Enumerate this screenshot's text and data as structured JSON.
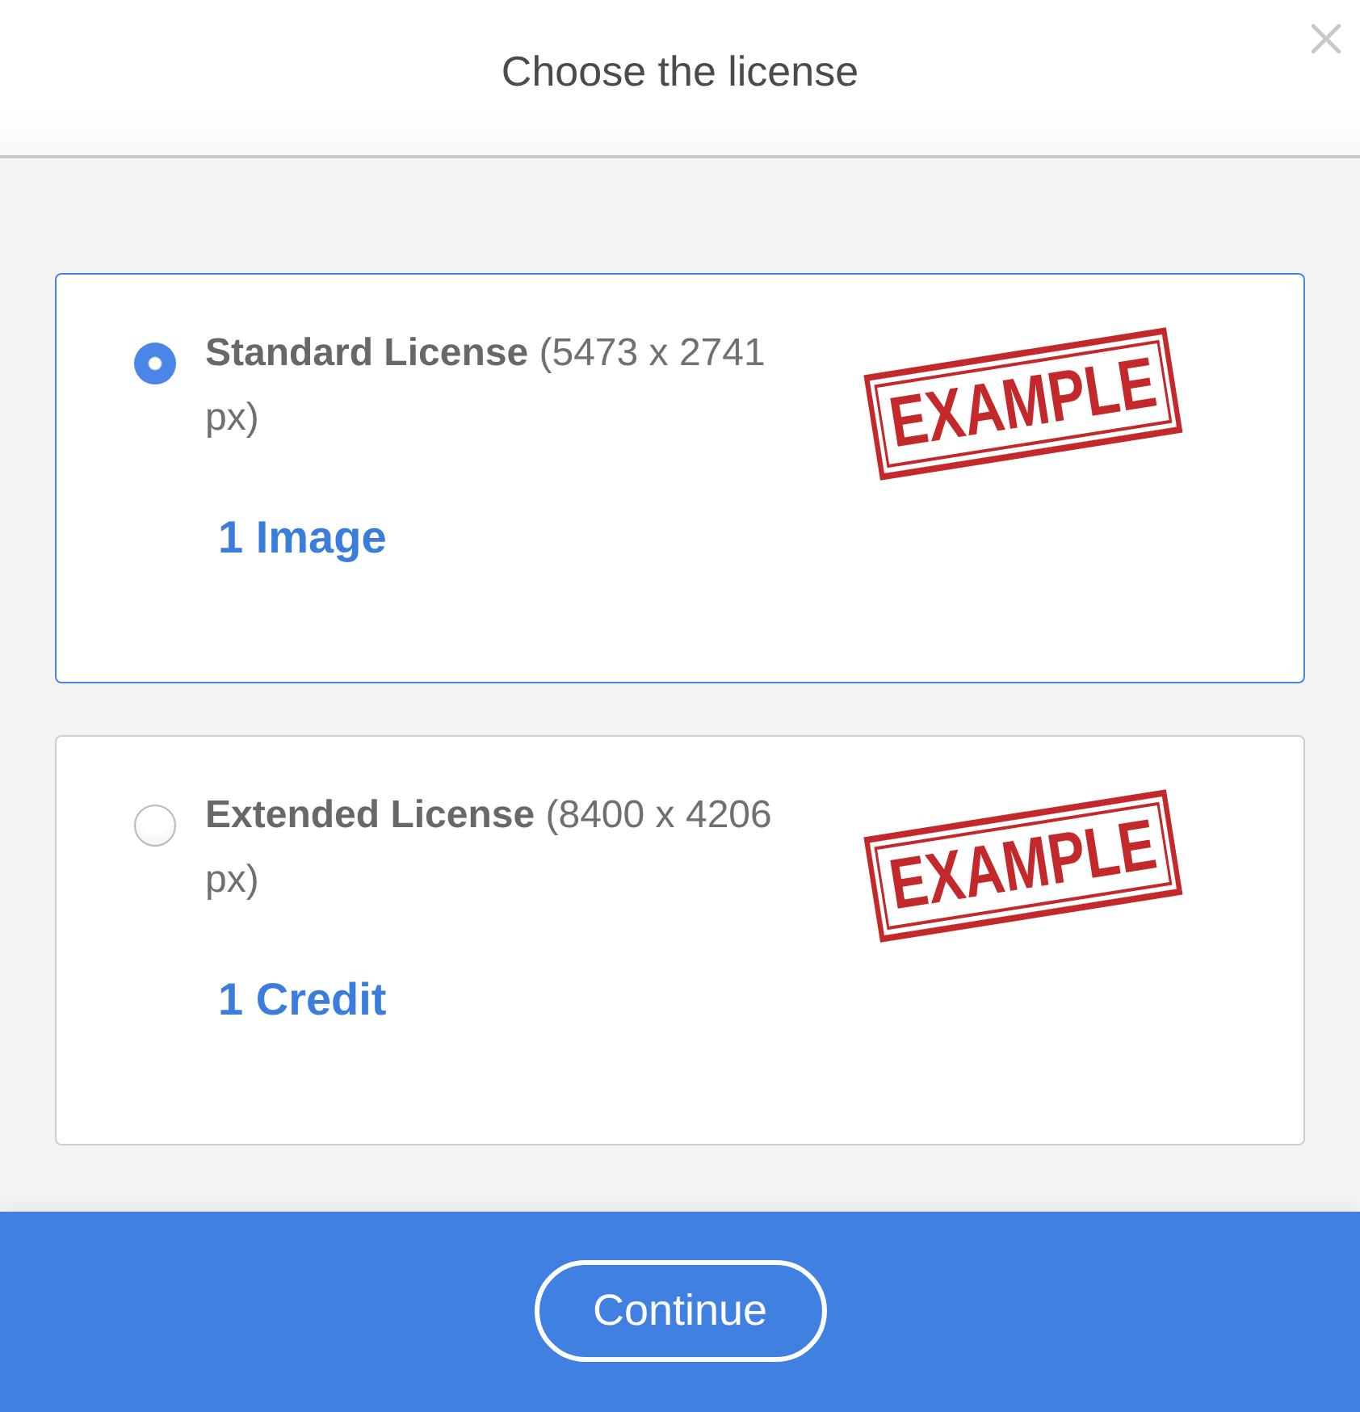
{
  "dialog": {
    "title": "Choose the license"
  },
  "licenses": [
    {
      "label": "**Standard License** (5473 x 2741 px)",
      "price": "1 Image",
      "stamp": "EXAMPLE",
      "selected": true
    },
    {
      "label": "**Extended License** (8400 x 4206 px)",
      "price": "1 Credit",
      "stamp": "EXAMPLE",
      "selected": false
    }
  ],
  "footer": {
    "button": "Continue"
  }
}
